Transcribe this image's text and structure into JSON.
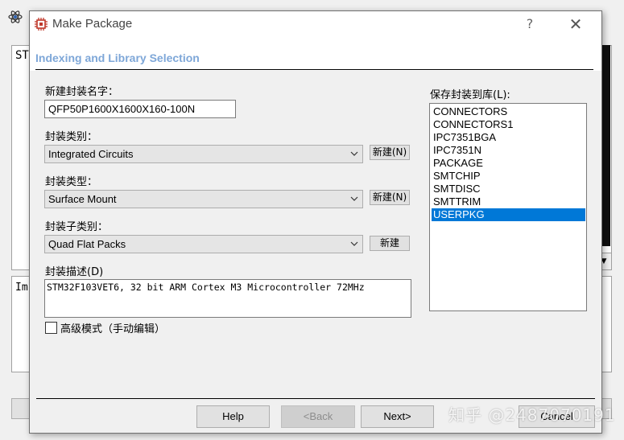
{
  "background": {
    "top_panel_text": "ST",
    "bottom_panel_text": "Im"
  },
  "dialog": {
    "title": "Make Package",
    "help_label": "?",
    "close_label": "✕",
    "header": "Indexing and Library Selection",
    "fields": {
      "name_label": "新建封装名字：",
      "name_value": "QFP50P1600X1600X160-100N",
      "category_label": "封装类别：",
      "category_value": "Integrated Circuits",
      "category_new": "新建(N)",
      "type_label": "封装类型：",
      "type_value": "Surface Mount",
      "type_new": "新建(N)",
      "subcategory_label": "封装子类别：",
      "subcategory_value": "Quad Flat Packs",
      "subcategory_new": "新建",
      "description_label": "封装描述(D)",
      "description_value": "STM32F103VET6, 32 bit ARM Cortex M3 Microcontroller 72MHz",
      "advanced_label": "高级模式（手动编辑）",
      "advanced_checked": false
    },
    "library": {
      "label": "保存封装到库(L):",
      "items": [
        "CONNECTORS",
        "CONNECTORS1",
        "IPC7351BGA",
        "IPC7351N",
        "PACKAGE",
        "SMTCHIP",
        "SMTDISC",
        "SMTTRIM",
        "USERPKG"
      ],
      "selected": "USERPKG"
    },
    "buttons": {
      "help": "Help",
      "back": "<Back",
      "next": "Next>",
      "cancel": "Cancel"
    }
  },
  "watermark": "知乎 @2487070191",
  "colors": {
    "header_text": "#7ea7d8",
    "selection": "#0078d7"
  }
}
